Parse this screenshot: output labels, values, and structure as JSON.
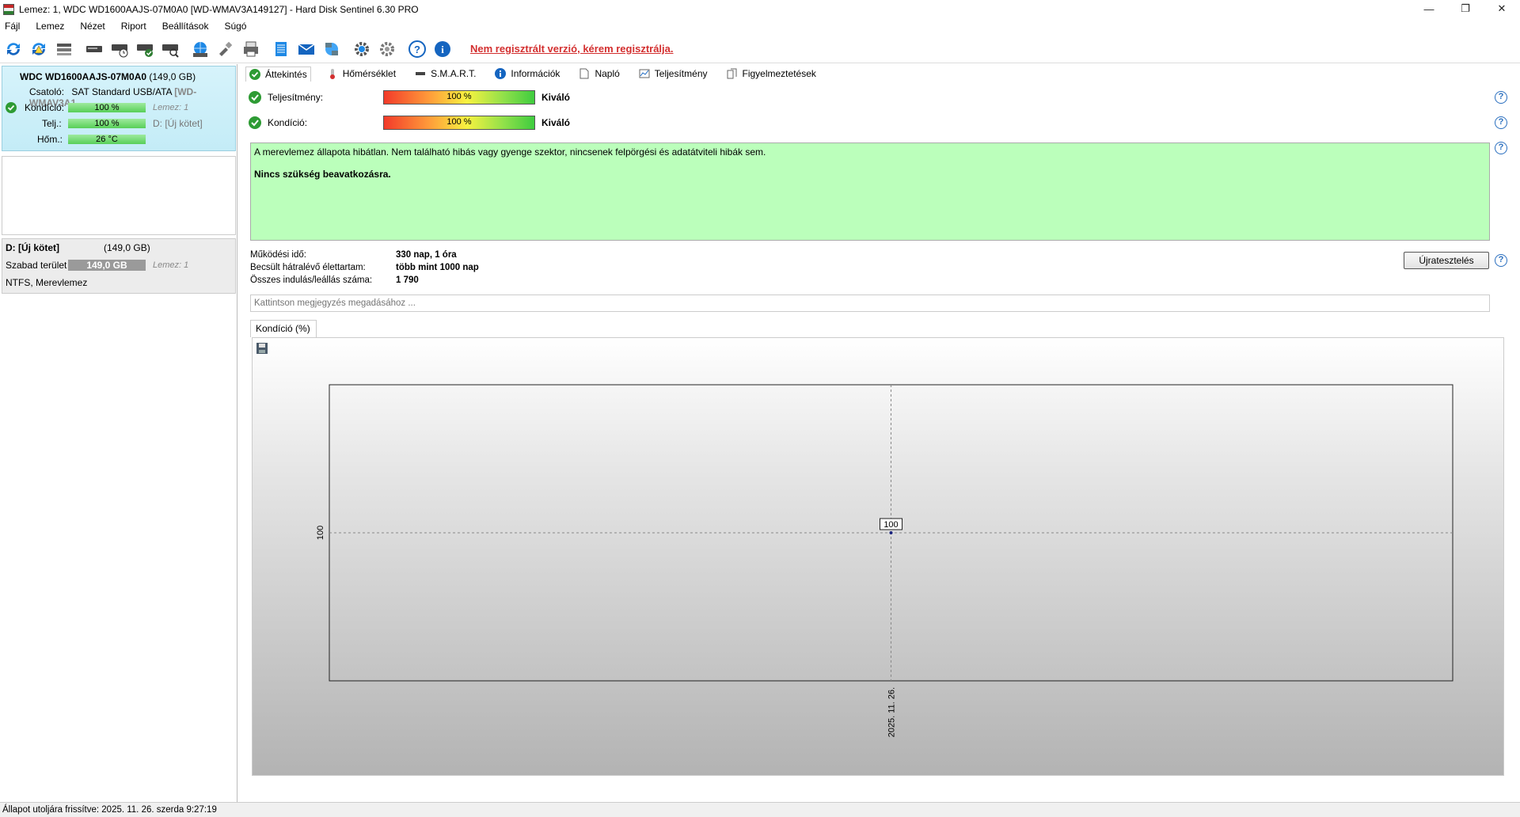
{
  "window": {
    "title": "Lemez: 1, WDC WD1600AAJS-07M0A0 [WD-WMAV3A149127]  -  Hard Disk Sentinel 6.30 PRO",
    "minimize": "—",
    "maximize": "❐",
    "close": "✕"
  },
  "menu": [
    "Fájl",
    "Lemez",
    "Nézet",
    "Riport",
    "Beállítások",
    "Súgó"
  ],
  "toolbar": {
    "icons": [
      "refresh-icon",
      "refresh-warning-icon",
      "disk-list-icon",
      "disk-icon",
      "disk-schedule-icon",
      "disk-check-icon",
      "disk-search-icon",
      "globe-disk-icon",
      "tools-icon",
      "printer-icon",
      "notepad-icon",
      "email-icon",
      "network-icon",
      "settings-icon",
      "settings-sound-icon",
      "help-icon",
      "info-icon"
    ],
    "registration_link": "Nem regisztrált verzió, kérem regisztrálja."
  },
  "disk": {
    "model": "WDC WD1600AAJS-07M0A0",
    "size": "(149,0 GB)",
    "interface_label": "Csatoló:",
    "interface_value": "SAT Standard USB/ATA",
    "serial": "[WD-WMAV3A1",
    "condition_label": "Kondíció:",
    "condition_value": "100 %",
    "performance_label": "Telj.:",
    "performance_value": "100 %",
    "temperature_label": "Hőm.:",
    "temperature_value": "26 °C",
    "disk_index": "Lemez: 1",
    "volume_ref": "D: [Új kötet]"
  },
  "volume": {
    "name": "D: [Új kötet]",
    "size": "(149,0 GB)",
    "free_label": "Szabad terület",
    "free_value": "149,0 GB",
    "disk_index": "Lemez: 1",
    "fs": "NTFS, Merevlemez"
  },
  "tabs": [
    "Áttekintés",
    "Hőmérséklet",
    "S.M.A.R.T.",
    "Információk",
    "Napló",
    "Teljesítmény",
    "Figyelmeztetések"
  ],
  "overview": {
    "performance_label": "Teljesítmény:",
    "performance_value": "100 %",
    "performance_word": "Kiváló",
    "condition_label": "Kondíció:",
    "condition_value": "100 %",
    "condition_word": "Kiváló",
    "status_text": "A merevlemez állapota hibátlan. Nem található hibás vagy gyenge szektor, nincsenek felpörgési és adatátviteli hibák sem.",
    "status_action": "Nincs szükség beavatkozásra.",
    "uptime_label": "Működési idő:",
    "uptime_value": "330 nap, 1 óra",
    "lifetime_label": "Becsült hátralévő élettartam:",
    "lifetime_value": "több mint 1000 nap",
    "startstop_label": "Összes indulás/leállás száma:",
    "startstop_value": "1 790",
    "retest_button": "Újratesztelés",
    "note_placeholder": "Kattintson megjegyzés megadásához ...",
    "help": "?"
  },
  "chart_tab": "Kondíció  (%)",
  "chart_data": {
    "type": "line",
    "x": [
      "2025. 11. 26."
    ],
    "series": [
      {
        "values": [
          100
        ]
      }
    ],
    "y_tick_labels": [
      "100"
    ],
    "point_labels": [
      "100"
    ],
    "grid": true
  },
  "statusbar": "Állapot utoljára frissítve: 2025. 11. 26. szerda 9:27:19"
}
